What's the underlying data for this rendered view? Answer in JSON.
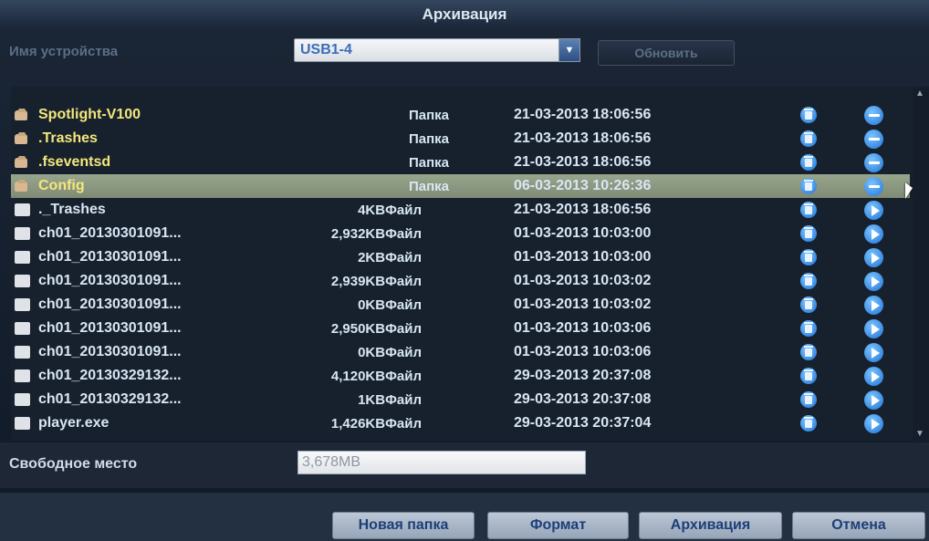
{
  "window": {
    "title": "Архивация"
  },
  "device": {
    "label": "Имя устройства",
    "selected": "USB1-4",
    "refresh_label": "Обновить"
  },
  "files": [
    {
      "name": "Spotlight-V100",
      "kind": "folder",
      "size": "",
      "type": "Папка",
      "date": "21-03-2013 18:06:56",
      "action": "enter"
    },
    {
      "name": ".Trashes",
      "kind": "folder",
      "size": "",
      "type": "Папка",
      "date": "21-03-2013 18:06:56",
      "action": "enter"
    },
    {
      "name": ".fseventsd",
      "kind": "folder",
      "size": "",
      "type": "Папка",
      "date": "21-03-2013 18:06:56",
      "action": "enter"
    },
    {
      "name": "Config",
      "kind": "folder",
      "size": "",
      "type": "Папка",
      "date": "06-03-2013 10:26:36",
      "action": "enter",
      "selected": true
    },
    {
      "name": "._Trashes",
      "kind": "file",
      "size": "4KB",
      "type": "Файл",
      "date": "21-03-2013 18:06:56",
      "action": "play"
    },
    {
      "name": "ch01_20130301091...",
      "kind": "file",
      "size": "2,932KB",
      "type": "Файл",
      "date": "01-03-2013 10:03:00",
      "action": "play"
    },
    {
      "name": "ch01_20130301091...",
      "kind": "file",
      "size": "2KB",
      "type": "Файл",
      "date": "01-03-2013 10:03:00",
      "action": "play"
    },
    {
      "name": "ch01_20130301091...",
      "kind": "file",
      "size": "2,939KB",
      "type": "Файл",
      "date": "01-03-2013 10:03:02",
      "action": "play"
    },
    {
      "name": "ch01_20130301091...",
      "kind": "file",
      "size": "0KB",
      "type": "Файл",
      "date": "01-03-2013 10:03:02",
      "action": "play"
    },
    {
      "name": "ch01_20130301091...",
      "kind": "file",
      "size": "2,950KB",
      "type": "Файл",
      "date": "01-03-2013 10:03:06",
      "action": "play"
    },
    {
      "name": "ch01_20130301091...",
      "kind": "file",
      "size": "0KB",
      "type": "Файл",
      "date": "01-03-2013 10:03:06",
      "action": "play"
    },
    {
      "name": "ch01_20130329132...",
      "kind": "file",
      "size": "4,120KB",
      "type": "Файл",
      "date": "29-03-2013 20:37:08",
      "action": "play"
    },
    {
      "name": "ch01_20130329132...",
      "kind": "file",
      "size": "1KB",
      "type": "Файл",
      "date": "29-03-2013 20:37:08",
      "action": "play"
    },
    {
      "name": "player.exe",
      "kind": "file",
      "size": "1,426KB",
      "type": "Файл",
      "date": "29-03-2013 20:37:04",
      "action": "play"
    }
  ],
  "free_space": {
    "label": "Свободное место",
    "value": "3,678MB"
  },
  "buttons": {
    "new_folder": "Новая папка",
    "format": "Формат",
    "backup": "Архивация",
    "cancel": "Отмена"
  },
  "icons": {
    "folder": "folder-icon",
    "file": "file-icon",
    "delete": "trash-icon",
    "enter": "enter-folder-icon",
    "play": "play-icon",
    "dropdown": "chevron-down-icon"
  },
  "colors": {
    "folder_name": "#f4e77a",
    "accent_blue": "#1f74d8",
    "selected_row": "#99a68e"
  }
}
